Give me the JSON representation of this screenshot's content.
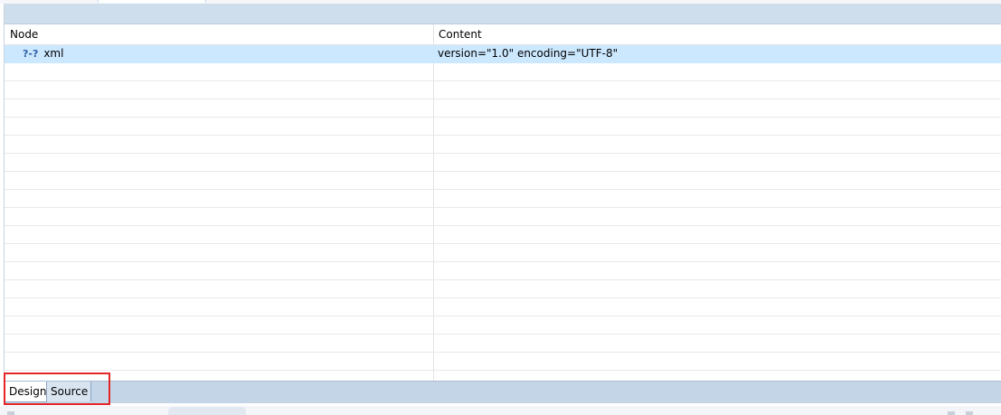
{
  "columns": {
    "node": "Node",
    "content": "Content"
  },
  "rows": [
    {
      "icon": "?-?",
      "node": "xml",
      "content": "version=\"1.0\" encoding=\"UTF-8\"",
      "selected": true
    }
  ],
  "empty_row_count": 17,
  "tabs": {
    "design": "Design",
    "source": "Source"
  },
  "colors": {
    "title_band": "#cfdeed",
    "selection": "#cce8ff",
    "highlight": "#e3262a",
    "tab_bar": "#c4d5e7"
  }
}
